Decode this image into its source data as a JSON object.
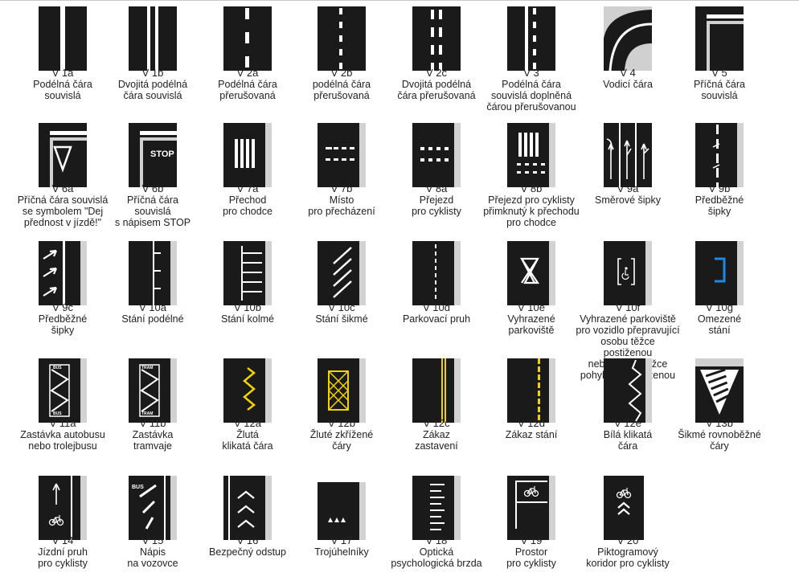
{
  "colors": {
    "road": "#1a1a1a",
    "line": "#ffffff",
    "yellow": "#f2d200",
    "blue": "#1e88e5",
    "edge": "#d2d2d2"
  },
  "signs": [
    {
      "code": "V 1a",
      "desc": [
        "Podélná čára",
        "souvislá"
      ],
      "icon": "solid-line-icon"
    },
    {
      "code": "V 1b",
      "desc": [
        "Dvojitá podélná",
        "čára souvislá"
      ],
      "icon": "double-solid-line-icon"
    },
    {
      "code": "V 2a",
      "desc": [
        "Podélná čára",
        "přerušovaná"
      ],
      "icon": "dashed-line-icon"
    },
    {
      "code": "V 2b",
      "desc": [
        "podélná čára",
        "přerušovaná"
      ],
      "icon": "short-dashed-line-icon"
    },
    {
      "code": "V 2c",
      "desc": [
        "Dvojitá podélná",
        "čára přerušovaná"
      ],
      "icon": "double-dashed-line-icon"
    },
    {
      "code": "V 3",
      "desc": [
        "Podélná čára",
        "souvislá doplněná",
        "čárou  přerušovanou"
      ],
      "icon": "solid-plus-dashed-line-icon"
    },
    {
      "code": "V 4",
      "desc": [
        "Vodicí čára"
      ],
      "icon": "guide-line-icon"
    },
    {
      "code": "V 5",
      "desc": [
        "Příčná čára",
        "souvislá"
      ],
      "icon": "stop-line-icon"
    },
    {
      "code": "V 6a",
      "desc": [
        "Příčná čára souvislá",
        "se symbolem \"Dej",
        "přednost v jízdě!\""
      ],
      "icon": "give-way-triangle-icon"
    },
    {
      "code": "V 6b",
      "desc": [
        "Příčná čára",
        "souvislá",
        "s nápisem STOP"
      ],
      "icon": "stop-text-icon",
      "text": "STOP"
    },
    {
      "code": "V 7a",
      "desc": [
        "Přechod",
        "pro chodce"
      ],
      "icon": "zebra-crossing-icon"
    },
    {
      "code": "V 7b",
      "desc": [
        "Místo",
        "pro přecházení"
      ],
      "icon": "crossing-place-icon"
    },
    {
      "code": "V 8a",
      "desc": [
        "Přejezd",
        "pro cyklisty"
      ],
      "icon": "bicycle-crossing-icon"
    },
    {
      "code": "V 8b",
      "desc": [
        "Přejezd pro cyklisty",
        "přimknutý k přechodu",
        "pro chodce"
      ],
      "icon": "combined-crossing-icon"
    },
    {
      "code": "V 9a",
      "desc": [
        "Směrové šipky"
      ],
      "icon": "direction-arrows-icon"
    },
    {
      "code": "V 9b",
      "desc": [
        "Předběžné",
        "šipky"
      ],
      "icon": "advance-arrows-line-icon"
    },
    {
      "code": "V 9c",
      "desc": [
        "Předběžné",
        "šipky"
      ],
      "icon": "advance-arrows-icon"
    },
    {
      "code": "V 10a",
      "desc": [
        "Stání podélné"
      ],
      "icon": "parallel-parking-icon"
    },
    {
      "code": "V 10b",
      "desc": [
        "Stání kolmé"
      ],
      "icon": "perpendicular-parking-icon"
    },
    {
      "code": "V 10c",
      "desc": [
        "Stání šikmé"
      ],
      "icon": "angled-parking-icon"
    },
    {
      "code": "V 10d",
      "desc": [
        "Parkovací pruh"
      ],
      "icon": "parking-lane-icon"
    },
    {
      "code": "V 10e",
      "desc": [
        "Vyhrazené",
        "parkoviště"
      ],
      "icon": "reserved-parking-icon"
    },
    {
      "code": "V 10f",
      "desc": [
        "Vyhrazené parkoviště",
        "pro vozidlo přepravující",
        "osobu těžce postiženou",
        "nebo osobu těžce",
        "pohybově postiženou"
      ],
      "icon": "disabled-parking-icon"
    },
    {
      "code": "V 10g",
      "desc": [
        "Omezené",
        "stání"
      ],
      "icon": "limited-parking-icon"
    },
    {
      "code": "V 11a",
      "desc": [
        "Zastávka  autobusu",
        "nebo trolejbusu"
      ],
      "icon": "bus-stop-icon",
      "text": "BUS"
    },
    {
      "code": "V 11b",
      "desc": [
        "Zastávka",
        "tramvaje"
      ],
      "icon": "tram-stop-icon",
      "text": "TRAM"
    },
    {
      "code": "V 12a",
      "desc": [
        "Žlutá",
        "klikatá čára"
      ],
      "icon": "yellow-zigzag-icon"
    },
    {
      "code": "V 12b",
      "desc": [
        "Žluté zkřížené",
        "čáry"
      ],
      "icon": "yellow-cross-hatch-icon"
    },
    {
      "code": "V 12c",
      "desc": [
        "Zákaz",
        "zastavení"
      ],
      "icon": "no-stopping-line-icon"
    },
    {
      "code": "V 12d",
      "desc": [
        "Zákaz stání"
      ],
      "icon": "no-parking-line-icon"
    },
    {
      "code": "V 12e",
      "desc": [
        "Bílá klikatá",
        "čára"
      ],
      "icon": "white-zigzag-icon"
    },
    {
      "code": "V 13b",
      "desc": [
        "Šikmé rovnoběžné",
        "čáry"
      ],
      "icon": "hatched-area-icon"
    },
    {
      "code": "V 14",
      "desc": [
        "Jízdní pruh",
        "pro cyklisty"
      ],
      "icon": "cycle-lane-icon"
    },
    {
      "code": "V 15",
      "desc": [
        "Nápis",
        "na vozovce"
      ],
      "icon": "road-text-icon",
      "text": "BUS"
    },
    {
      "code": "V 16",
      "desc": [
        "Bezpečný odstup"
      ],
      "icon": "safe-distance-chevrons-icon"
    },
    {
      "code": "V 17",
      "desc": [
        "Trojúhelníky"
      ],
      "icon": "triangles-icon"
    },
    {
      "code": "V 18",
      "desc": [
        "Optická",
        "psychologická brzda"
      ],
      "icon": "optical-brake-icon"
    },
    {
      "code": "V 19",
      "desc": [
        "Prostor",
        "pro cyklisty"
      ],
      "icon": "cyclist-box-icon"
    },
    {
      "code": "V 20",
      "desc": [
        "Piktogramový",
        "koridor pro cyklisty"
      ],
      "icon": "sharrow-icon"
    }
  ]
}
